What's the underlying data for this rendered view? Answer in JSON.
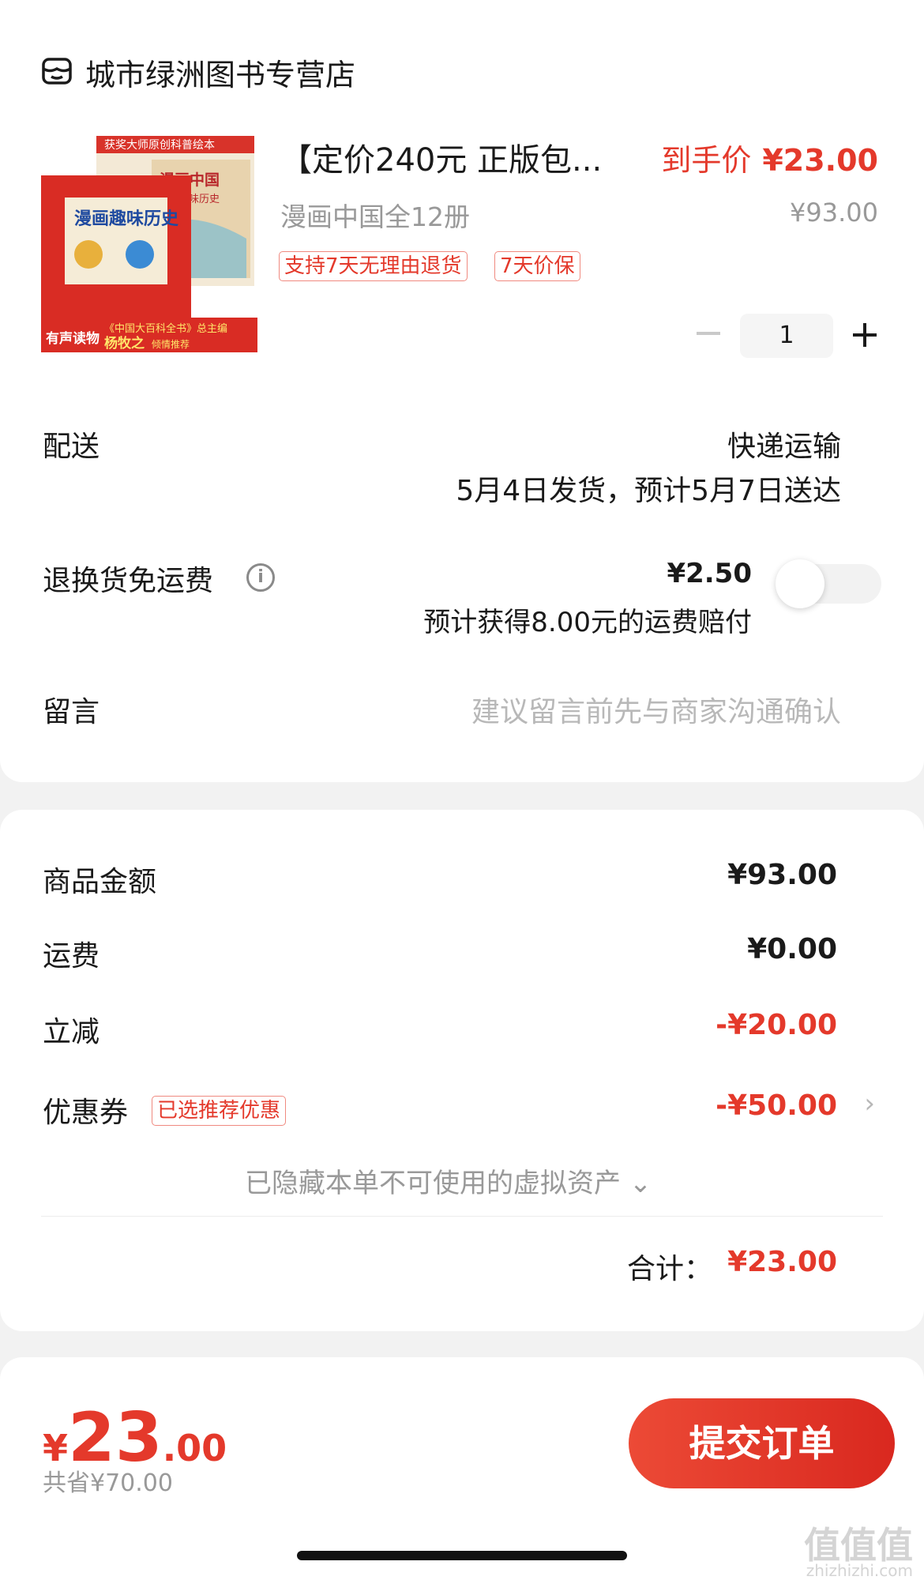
{
  "store": {
    "name": "城市绿洲图书专营店",
    "icon": "store-icon"
  },
  "product": {
    "title": "【定价240元 正版包...",
    "subtitle": "漫画中国全12册",
    "price_label": "到手价",
    "price": "¥23.00",
    "original_price": "¥93.00",
    "tags": [
      "支持7天无理由退货",
      "7天价保"
    ],
    "quantity": "1",
    "cover": {
      "top_banner": "获奖大师原创科普绘本",
      "book1_title": "漫画中国",
      "book1_sub": "漫画趣味历史",
      "book2_title": "漫画趣味历史",
      "badge": "有声读物",
      "footer_line": "《中国大百科全书》总主编",
      "author": "杨牧之",
      "author_note": "倾情推荐"
    }
  },
  "shipping": {
    "label": "配送",
    "method": "快递运输",
    "schedule": "5月4日发货，预计5月7日送达"
  },
  "insurance": {
    "label": "退换货免运费",
    "price": "¥2.50",
    "note": "预计获得8.00元的运费赔付",
    "toggle_on": false
  },
  "message": {
    "label": "留言",
    "placeholder": "建议留言前先与商家沟通确认"
  },
  "summary": {
    "goods_label": "商品金额",
    "goods_value": "¥93.00",
    "freight_label": "运费",
    "freight_value": "¥0.00",
    "discount_label": "立减",
    "discount_value": "-¥20.00",
    "coupon_label": "优惠券",
    "coupon_tag": "已选推荐优惠",
    "coupon_value": "-¥50.00",
    "hidden_assets": "已隐藏本单不可使用的虚拟资产 ⌄",
    "total_label": "合计：",
    "total_value": "¥23.00"
  },
  "bottom": {
    "currency": "¥",
    "price_int": "23",
    "price_dec": ".00",
    "saved": "共省¥70.00",
    "submit_label": "提交订单"
  },
  "watermark": {
    "text": "值值值",
    "url": "zhizhizhi.com"
  },
  "colors": {
    "accent": "#e4392b",
    "muted": "#999999"
  }
}
